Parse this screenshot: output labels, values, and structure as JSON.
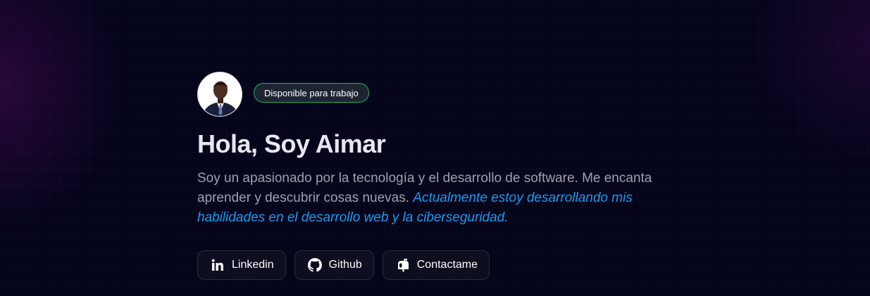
{
  "profile": {
    "badge": "Disponible para trabajo",
    "title": "Hola, Soy Aimar",
    "description_plain": "Soy un apasionado por la tecnología y el desarrollo de software. Me encanta aprender y descubrir cosas nuevas. ",
    "description_highlight": "Actualmente estoy desarrollando mis habilidades en el desarrollo web y la ciberseguridad."
  },
  "links": [
    {
      "label": "Linkedin",
      "icon": "linkedin-icon"
    },
    {
      "label": "Github",
      "icon": "github-icon"
    },
    {
      "label": "Contactame",
      "icon": "mailbox-icon"
    }
  ],
  "colors": {
    "background": "#04041b",
    "badge_border": "#22b455",
    "highlight": "#1b9bf0",
    "title": "#e6e7f0",
    "text_muted": "#9ea0b0"
  }
}
